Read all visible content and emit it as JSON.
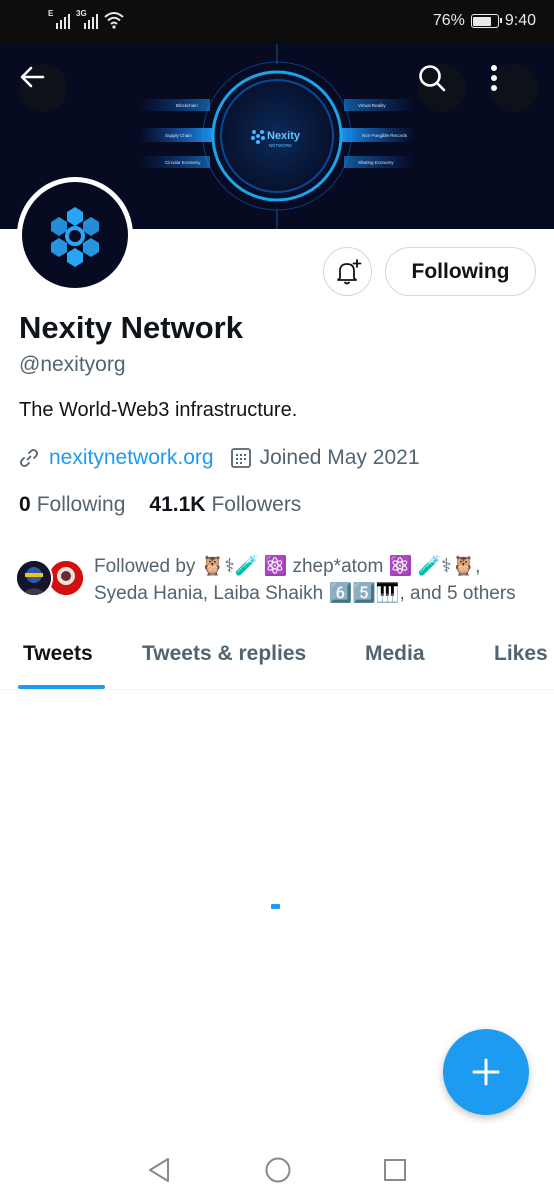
{
  "status_bar": {
    "signal1_label": "E",
    "signal2_label": "3G",
    "battery_percent": "76%",
    "battery_level": 0.76,
    "time": "9:40"
  },
  "banner": {
    "brand": "Nexity",
    "brand_sub": "NETWORK",
    "left_labels": [
      "Blockchain",
      "Supply Chain",
      "Circular Economy"
    ],
    "right_labels": [
      "Virtual Reality",
      "Non-Fungible Records",
      "Sharing Economy"
    ]
  },
  "header": {
    "back_icon": "arrow-left-icon",
    "search_icon": "search-icon",
    "more_icon": "more-vertical-icon"
  },
  "profile": {
    "name": "Nexity Network",
    "handle": "@nexityorg",
    "bio": "The World-Web3 infrastructure.",
    "website": "nexitynetwork.org",
    "joined": "Joined May 2021",
    "following_count": "0",
    "following_label": "Following",
    "followers_count": "41.1K",
    "followers_label": "Followers",
    "followed_by_prefix": "Followed by",
    "followed_by_line1_names": "🦉⚕🧪 ⚛️ zhep*atom ⚛️ 🧪⚕🦉,",
    "followed_by_line2": "Syeda Hania, Laiba Shaikh 6️⃣5️⃣🎹, and 5 others"
  },
  "actions": {
    "notify_icon": "bell-plus-icon",
    "following_button": "Following"
  },
  "tabs": [
    {
      "label": "Tweets",
      "active": true
    },
    {
      "label": "Tweets & replies",
      "active": false
    },
    {
      "label": "Media",
      "active": false
    },
    {
      "label": "Likes",
      "active": false
    }
  ],
  "fab": {
    "icon": "plus-icon"
  },
  "navbar": {
    "items": [
      "back-triangle-icon",
      "home-circle-icon",
      "recents-square-icon"
    ]
  },
  "colors": {
    "accent": "#1d9bf0",
    "text_primary": "#0f1419",
    "text_secondary": "#536471",
    "banner_bg": "#060b22"
  }
}
